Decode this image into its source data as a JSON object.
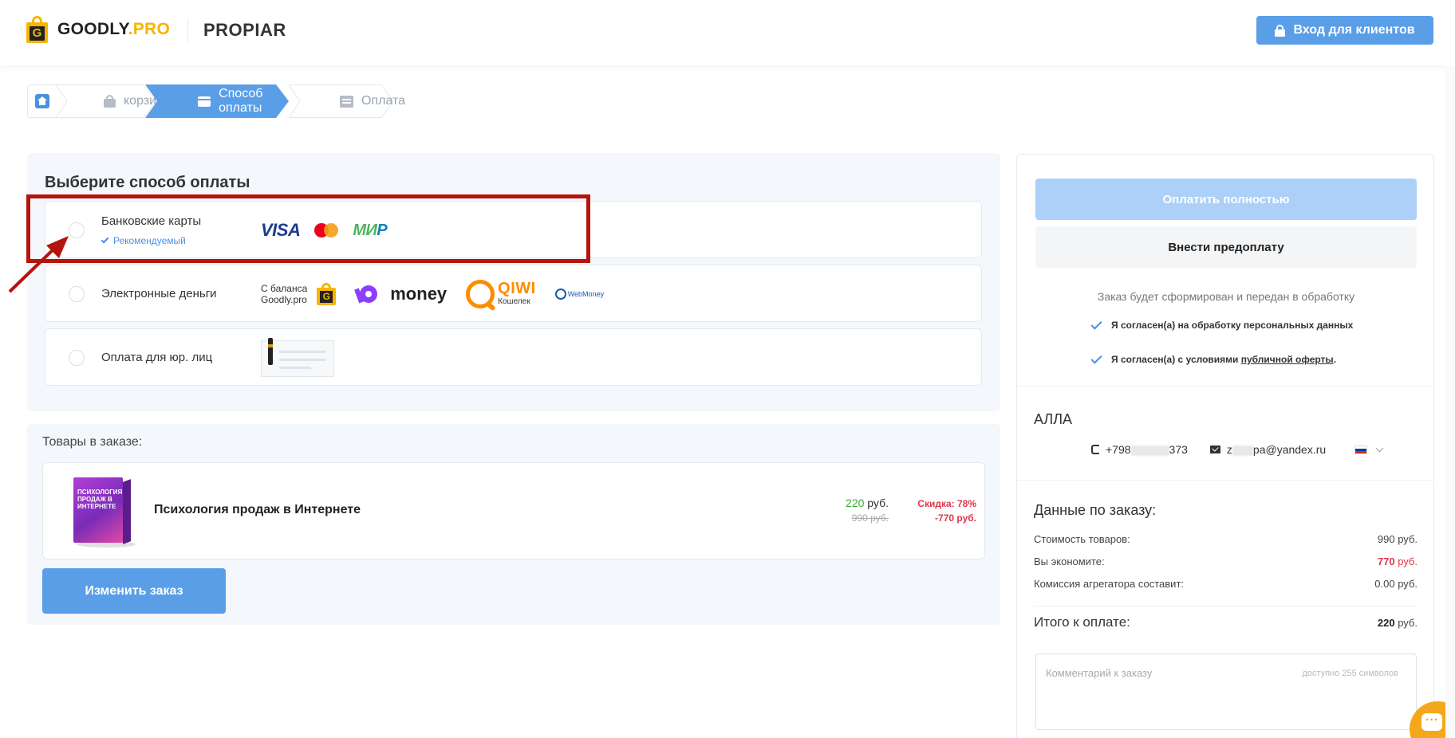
{
  "header": {
    "logo_letter": "G",
    "logo_main": "GOODLY",
    "logo_suffix": ".PRO",
    "brand": "PROPIAR",
    "login_button": "Вход для клиентов"
  },
  "breadcrumb": {
    "steps": [
      {
        "label": "корзина",
        "state": "done"
      },
      {
        "label": "Способ оплаты",
        "state": "active"
      },
      {
        "label": "Оплата",
        "state": "pending"
      }
    ],
    "active_color": "#5a9ee8"
  },
  "payment": {
    "title": "Выберите способ оплаты",
    "options": [
      {
        "label": "Банковские карты",
        "badge": "Рекомендуемый",
        "logos": [
          "VISA",
          "MasterCard",
          "МИР"
        ]
      },
      {
        "label": "Электронные деньги",
        "balance_line1": "С баланса",
        "balance_line2": "Goodly.pro",
        "umoney": "money",
        "qiwi": "QIWI",
        "qiwi_sub": "Кошелек",
        "webmoney": "WebMoney"
      },
      {
        "label": "Оплата для юр. лиц"
      }
    ],
    "card_logos": {
      "visa": "VISA",
      "mir_1": "МИ",
      "mir_2": "Р"
    },
    "highlight_color": "#b5140d"
  },
  "order": {
    "title": "Товары в заказе:",
    "items": [
      {
        "name": "Психология продаж в Интернете",
        "cover_text": "ПСИХОЛОГИЯ ПРОДАЖ В ИНТЕРНЕТЕ",
        "price": "220",
        "currency": "руб.",
        "old_price": "990 руб.",
        "discount": "Скидка: 78%",
        "discount_amount": "-770 руб."
      }
    ],
    "change_button": "Изменить заказ"
  },
  "sidebar": {
    "pay_full_button": "Оплатить полностью",
    "prepay_button": "Внести предоплату",
    "note": "Заказ будет сформирован и передан в обработку",
    "agree_personal": "Я согласен(а) на обработку персональных данных",
    "agree_terms_prefix": "Я согласен(а) с условиями ",
    "agree_terms_link": "публичной оферты",
    "agree_terms_suffix": ".",
    "client": {
      "name": "АЛЛА",
      "phone_start": "+798",
      "phone_end": "373",
      "email_start": "z",
      "email_end": "pa@yandex.ru"
    },
    "summary": {
      "title": "Данные по заказу:",
      "rows": [
        {
          "label": "Стоимость товаров:",
          "value": "990 руб."
        },
        {
          "label": "Вы экономите:",
          "value_num": "770",
          "value_unit": " руб."
        },
        {
          "label": "Комиссия агрегатора составит:",
          "value": "0.00 руб."
        }
      ],
      "total_label": "Итого к оплате:",
      "total_num": "220",
      "total_unit": " руб."
    },
    "comment_placeholder": "Комментарий к заказу",
    "comment_limit": "доступно 255 символов"
  }
}
